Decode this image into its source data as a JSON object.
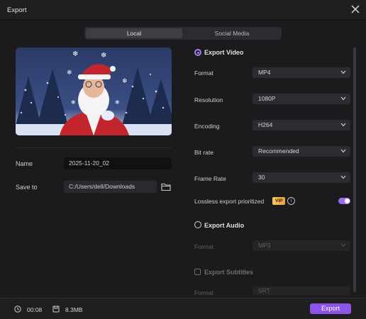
{
  "window": {
    "title": "Export"
  },
  "tabs": [
    {
      "label": "Local",
      "active": true
    },
    {
      "label": "Social Media",
      "active": false
    }
  ],
  "file": {
    "name_label": "Name",
    "name_value": "2025-11-20_02",
    "save_label": "Save to",
    "save_value": "C:/Users/dell/Downloads"
  },
  "video": {
    "heading": "Export Video",
    "format": {
      "label": "Format",
      "value": "MP4"
    },
    "resolution": {
      "label": "Resolution",
      "value": "1080P"
    },
    "encoding": {
      "label": "Encoding",
      "value": "H264"
    },
    "bitrate": {
      "label": "Bit rate",
      "value": "Recommended"
    },
    "framerate": {
      "label": "Frame Rate",
      "value": "30"
    },
    "lossless": {
      "label": "Lossless export prioritized",
      "badge": "VIP",
      "info_glyph": "i",
      "enabled": true
    }
  },
  "audio": {
    "heading": "Export Audio",
    "format": {
      "label": "Format",
      "value": "MP3"
    }
  },
  "subtitles": {
    "heading": "Export Subtitles",
    "format": {
      "label": "Format",
      "value": "SRT"
    }
  },
  "footer": {
    "duration": "00:08",
    "size": "8.3MB",
    "export_label": "Export"
  },
  "colors": {
    "accent": "#8c55e8",
    "background": "#1b1b1d"
  }
}
